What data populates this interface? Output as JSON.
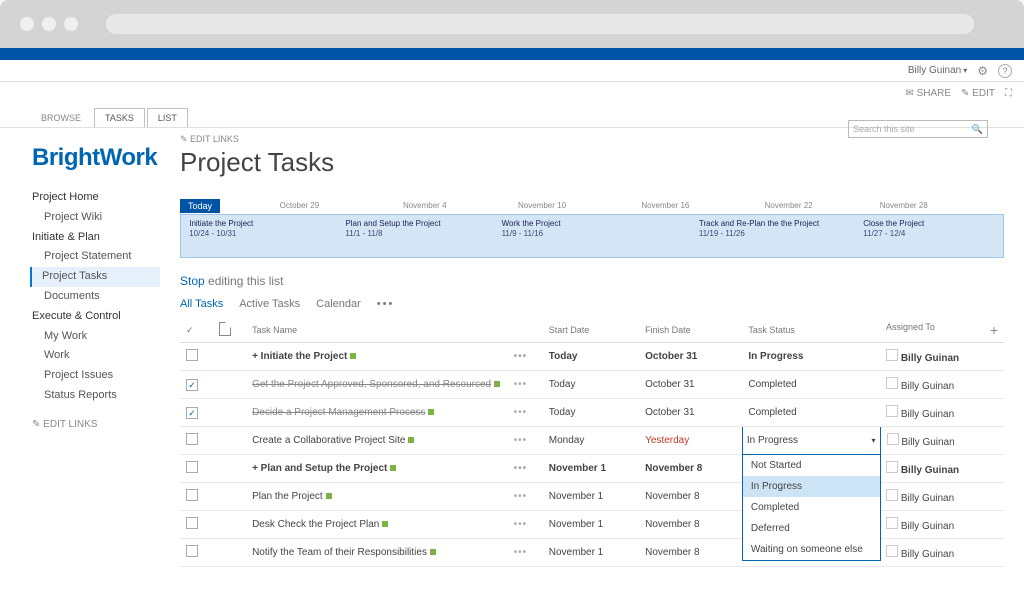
{
  "user": {
    "name": "Billy Guinan"
  },
  "actions": {
    "share": "SHARE",
    "edit": "EDIT"
  },
  "tabs": {
    "browse": "BROWSE",
    "tasks": "TASKS",
    "list": "LIST"
  },
  "logo": "BrightWork",
  "nav": {
    "home": "Project Home",
    "wiki": "Project Wiki",
    "initiate": "Initiate & Plan",
    "statement": "Project Statement",
    "tasks": "Project Tasks",
    "docs": "Documents",
    "exec": "Execute & Control",
    "mywork": "My Work",
    "work": "Work",
    "issues": "Project Issues",
    "status": "Status Reports",
    "editlinks": "EDIT LINKS"
  },
  "page": {
    "editlinks": "EDIT LINKS",
    "title": "Project Tasks"
  },
  "search": {
    "placeholder": "Search this site"
  },
  "timeline": {
    "today": "Today",
    "dates": {
      "o29": "October 29",
      "n4": "November 4",
      "n10": "November 10",
      "n16": "November 16",
      "n22": "November 22",
      "n28": "November 28"
    },
    "items": [
      {
        "t": "Initiate the Project",
        "d": "10/24 - 10/31"
      },
      {
        "t": "Plan and Setup the Project",
        "d": "11/1 - 11/8"
      },
      {
        "t": "Work the Project",
        "d": "11/9 - 11/16"
      },
      {
        "t": "Track and Re-Plan the the Project",
        "d": "11/19 - 11/26"
      },
      {
        "t": "Close the Project",
        "d": "11/27 - 12/4"
      }
    ]
  },
  "stop": {
    "a": "Stop",
    "b": "editing this list"
  },
  "viewtabs": {
    "all": "All Tasks",
    "active": "Active Tasks",
    "cal": "Calendar"
  },
  "cols": {
    "name": "Task Name",
    "start": "Start Date",
    "finish": "Finish Date",
    "status": "Task Status",
    "assigned": "Assigned To"
  },
  "rows": [
    {
      "ck": false,
      "name": "Initiate the Project",
      "prefix": "+ ",
      "bold": true,
      "strike": false,
      "start": "Today",
      "finish": "October 31",
      "status": "In Progress",
      "assigned": "Billy Guinan"
    },
    {
      "ck": true,
      "name": "Get the Project Approved, Sponsored, and Resourced",
      "prefix": "",
      "bold": false,
      "strike": true,
      "start": "Today",
      "finish": "October 31",
      "status": "Completed",
      "assigned": "Billy Guinan"
    },
    {
      "ck": true,
      "name": "Decide a Project Management Process",
      "prefix": "",
      "bold": false,
      "strike": true,
      "start": "Today",
      "finish": "October 31",
      "status": "Completed",
      "assigned": "Billy Guinan"
    },
    {
      "ck": false,
      "name": "Create a Collaborative Project Site",
      "prefix": "",
      "bold": false,
      "strike": false,
      "start": "Monday",
      "finish": "Yesterday",
      "finishRed": true,
      "status": "In Progress",
      "assigned": "Billy Guinan",
      "dropdown": true
    },
    {
      "ck": false,
      "name": "Plan and Setup the Project",
      "prefix": "+ ",
      "bold": true,
      "strike": false,
      "start": "November 1",
      "finish": "November 8",
      "status": "",
      "assigned": "Billy Guinan"
    },
    {
      "ck": false,
      "name": "Plan the Project",
      "prefix": "",
      "bold": false,
      "strike": false,
      "start": "November 1",
      "finish": "November 8",
      "status": "",
      "assigned": "Billy Guinan"
    },
    {
      "ck": false,
      "name": "Desk Check the Project Plan",
      "prefix": "",
      "bold": false,
      "strike": false,
      "start": "November 1",
      "finish": "November 8",
      "status": "",
      "assigned": "Billy Guinan"
    },
    {
      "ck": false,
      "name": "Notify the Team of their Responsibilities",
      "prefix": "",
      "bold": false,
      "strike": false,
      "start": "November 1",
      "finish": "November 8",
      "status": "",
      "assigned": "Billy Guinan"
    }
  ],
  "dropdown": {
    "opts": [
      "Not Started",
      "In Progress",
      "Completed",
      "Deferred",
      "Waiting on someone else"
    ],
    "selected": "In Progress"
  }
}
